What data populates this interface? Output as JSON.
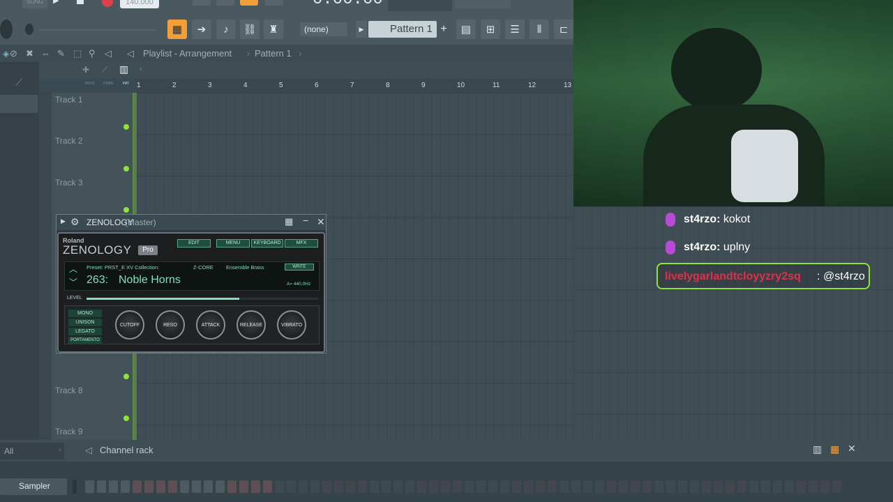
{
  "toolbar": {
    "tempo": "140.000",
    "timecode": "0:00:00",
    "song_label": "SONG",
    "pattern_selector_none": "(none)",
    "pattern_name": "Pattern 1",
    "plus": "+"
  },
  "playlist": {
    "breadcrumb": [
      "Playlist - Arrangement",
      "Pattern 1"
    ],
    "tool_labels": [
      "NOTE",
      "CHAN",
      "PAT"
    ],
    "ruler": [
      "1",
      "2",
      "3",
      "4",
      "5",
      "6",
      "7",
      "8",
      "9",
      "10",
      "11",
      "12",
      "13"
    ],
    "tracks": [
      "Track 1",
      "Track 2",
      "Track 3",
      "Track 8",
      "Track 9"
    ]
  },
  "plugin": {
    "title": "ZENOLOGY",
    "subtitle": "(Master)",
    "brand": "Roland",
    "product": "ZENOLOGY",
    "edition": "Pro",
    "buttons": [
      "EDIT",
      "MENU",
      "KEYBOARD",
      "MFX"
    ],
    "preset_label": "Preset: PRST_E XV Collection:",
    "engine": "Z-CORE",
    "category": "Ensemble Brass",
    "write_label": "WRITE",
    "preset_number": "263:",
    "preset_name": "Noble Horns",
    "tuning": "A= 440.0Hz",
    "level_label": "LEVEL",
    "level": 0.66,
    "voice_modes": [
      "MONO",
      "UNISON",
      "LEGATO",
      "PORTAMENTO"
    ],
    "knobs": [
      "CUTOFF",
      "RESO",
      "ATTACK",
      "RELEASE",
      "VIBRATO"
    ]
  },
  "chat": [
    {
      "user": "st4rzo",
      "message": "kokot"
    },
    {
      "user": "st4rzo",
      "message": "uplny"
    },
    {
      "user": "livelygarlandtcloyyzry2sq",
      "message": "@st4rzo"
    }
  ],
  "channel_rack": {
    "filter": "All",
    "title": "Channel rack",
    "channel": "Sampler"
  },
  "colors": {
    "accent_orange": "#f29f3a",
    "led_green": "#8ee43a",
    "zen_teal": "#58a886",
    "highlight_user": "#e0304a"
  }
}
